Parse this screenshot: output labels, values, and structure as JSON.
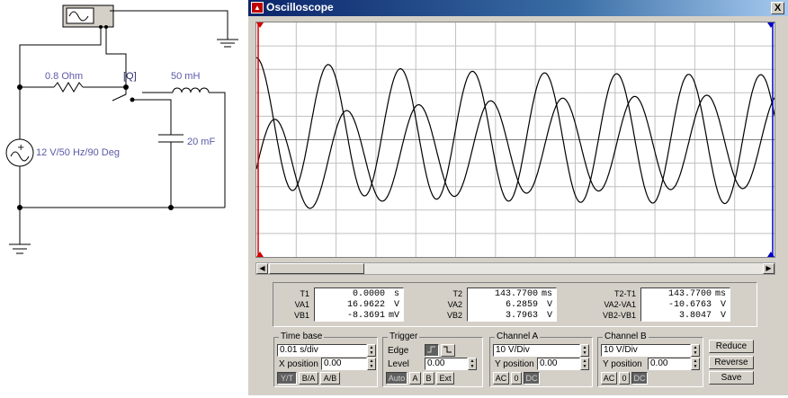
{
  "schematic": {
    "resistor_label": "0.8  Ohm",
    "switch_label": "[Q]",
    "inductor_label": "50 mH",
    "capacitor_label": "20 mF",
    "source_label": "12 V/50 Hz/90 Deg"
  },
  "window": {
    "title": "Oscilloscope",
    "close_label": "X",
    "marker_1": "1",
    "marker_2": "2"
  },
  "readout": {
    "t1_label": "T1",
    "va1_label": "VA1",
    "vb1_label": "VB1",
    "t1": "0.0000",
    "t1_unit": "s",
    "va1": "16.9622",
    "va1_unit": "V",
    "vb1": "-8.3691",
    "vb1_unit": "mV",
    "t2_label": "T2",
    "va2_label": "VA2",
    "vb2_label": "VB2",
    "t2": "143.7700",
    "t2_unit": "ms",
    "va2": "6.2859",
    "va2_unit": "V",
    "vb2": "3.7963",
    "vb2_unit": "V",
    "t2t1_label": "T2-T1",
    "va2va1_label": "VA2-VA1",
    "vb2vb1_label": "VB2-VB1",
    "t2t1": "143.7700",
    "t2t1_unit": "ms",
    "va2va1": "-10.6763",
    "va2va1_unit": "V",
    "vb2vb1": "3.8047",
    "vb2vb1_unit": "V"
  },
  "timebase": {
    "title": "Time base",
    "value": "0.01 s/div",
    "xpos_label": "X position",
    "xpos": "0.00",
    "modes": [
      "Y/T",
      "B/A",
      "A/B"
    ],
    "active_mode": "Y/T"
  },
  "trigger": {
    "title": "Trigger",
    "edge_label": "Edge",
    "level_label": "Level",
    "level": "0.00",
    "modes": [
      "Auto",
      "A",
      "B",
      "Ext"
    ]
  },
  "channel_a": {
    "title": "Channel A",
    "value": "10 V/Div",
    "ypos_label": "Y position",
    "ypos": "0.00",
    "coupling": [
      "AC",
      "0",
      "DC"
    ]
  },
  "channel_b": {
    "title": "Channel B",
    "value": "10 V/Div",
    "ypos_label": "Y position",
    "ypos": "0.00",
    "coupling": [
      "AC",
      "0",
      "DC"
    ]
  },
  "buttons": {
    "reduce": "Reduce",
    "reverse": "Reverse",
    "save": "Save"
  },
  "colors": {
    "titlebar": "#0a246a",
    "cursor1": "#d00000",
    "cursor2": "#0000c0",
    "trace": "#000000",
    "grid": "#c0c0c0"
  },
  "chart_data": {
    "type": "line",
    "xlabel": "",
    "ylabel": "",
    "x_unit_per_div": "0.01 s/div",
    "y_unit_per_div": "10 V/Div",
    "xlim": [
      0,
      0.1438
    ],
    "ylim": [
      -40,
      40
    ],
    "grid": true,
    "series": [
      {
        "amplitude": 22,
        "freq": 50,
        "phase_deg": 90,
        "decay_amp": 6,
        "decay_tau": 0.04
      },
      {
        "amplitude": 16,
        "freq": 50,
        "phase_deg": 0,
        "decay_amp": -10,
        "decay_tau": 0.05
      }
    ]
  }
}
